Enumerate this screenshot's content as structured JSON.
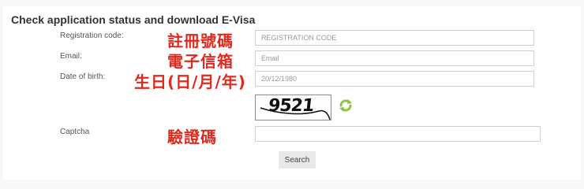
{
  "form": {
    "title": "Check application status and download E-Visa",
    "registration": {
      "label": "Registration code:",
      "annotation": "註冊號碼",
      "placeholder": "REGISTRATION CODE",
      "value": ""
    },
    "email": {
      "label": "Email:",
      "annotation": "電子信箱",
      "placeholder": "Email",
      "value": ""
    },
    "dob": {
      "label": "Date of birth:",
      "annotation": "生日(日/月/年)",
      "placeholder": "20/12/1980",
      "value": ""
    },
    "captcha": {
      "label": "Captcha",
      "annotation": "驗證碼",
      "image_text": "9521",
      "refresh_icon": "refresh-icon",
      "value": ""
    },
    "search_label": "Search"
  },
  "colors": {
    "annotation": "#e02a1f",
    "refresh_icon": "#8cc63f",
    "button_bg": "#e9e9e9"
  }
}
